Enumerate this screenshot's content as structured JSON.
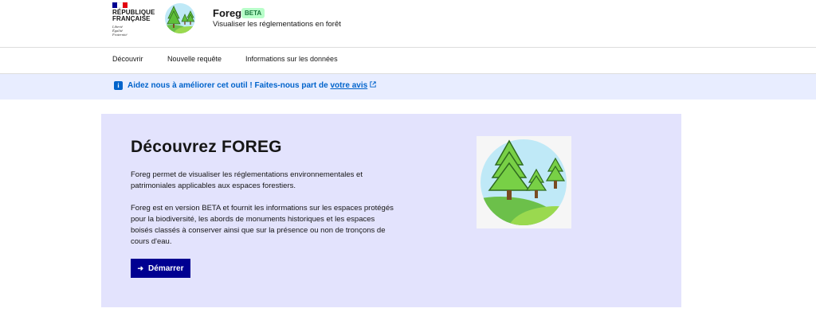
{
  "brand": {
    "republic_line1": "RÉPUBLIQUE",
    "republic_line2": "FRANÇAISE",
    "motto_1": "Liberté",
    "motto_2": "Égalité",
    "motto_3": "Fraternité",
    "flag_colors": [
      "#000091",
      "#ffffff",
      "#e1000f"
    ]
  },
  "site": {
    "name": "Foreg",
    "badge": "BETA",
    "tagline": "Visualiser les réglementations en forêt",
    "logo_icon": "forest-logo-icon"
  },
  "nav": {
    "items": [
      "Découvrir",
      "Nouvelle requête",
      "Informations sur les données"
    ]
  },
  "notice": {
    "text": "Aidez nous à améliorer cet outil ! Faites-nous part de ",
    "link_text": "votre avis",
    "icon": "info-icon"
  },
  "hero": {
    "title": "Découvrez FOREG",
    "paragraph_1": "Foreg permet de visualiser les réglementations environnementales et patrimoniales applicables aux espaces forestiers.",
    "paragraph_2": "Foreg est en version BETA et fournit les informations sur les espaces protégés pour la biodiversité, les abords de monuments historiques et les espaces boisés classés à conserver ainsi que sur la présence ou non de tronçons de cours d'eau.",
    "button_label": "Démarrer",
    "illustration": "forest-illustration"
  },
  "colors": {
    "primary": "#000091",
    "info": "#0063cb",
    "notice_bg": "#e8edff",
    "card_bg": "#e3e3fd",
    "badge_bg": "#b8fec9",
    "badge_text": "#18753c"
  }
}
